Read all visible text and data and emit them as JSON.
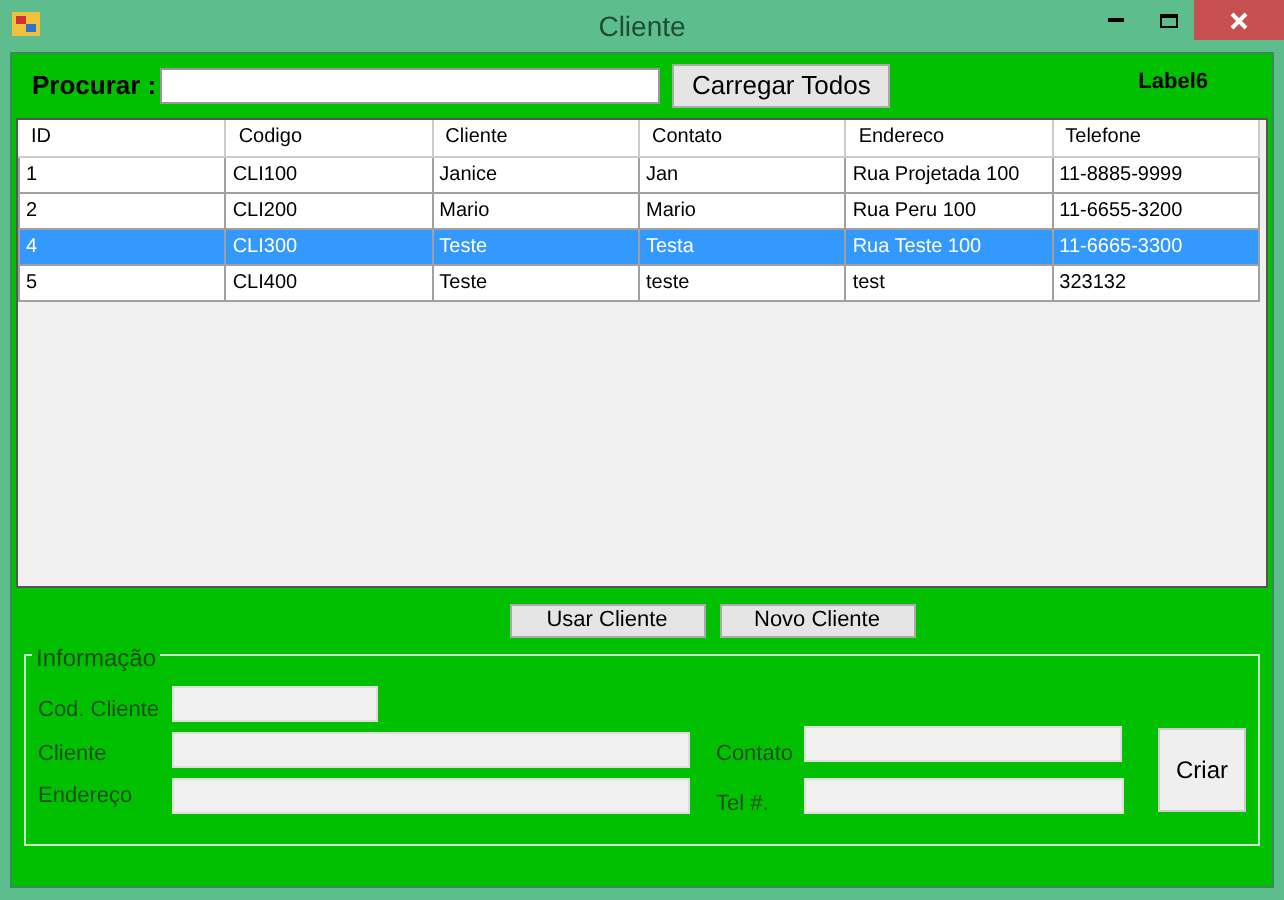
{
  "window": {
    "title": "Cliente"
  },
  "search": {
    "label": "Procurar :"
  },
  "load_all_button": "Carregar Todos",
  "status_label": "Label6",
  "table": {
    "columns": [
      "ID",
      "Codigo",
      "Cliente",
      "Contato",
      "Endereco",
      "Telefone"
    ],
    "rows": [
      {
        "cells": [
          "1",
          "CLI100",
          "Janice",
          "Jan",
          "Rua Projetada 100",
          "11-8885-9999"
        ],
        "selected": false
      },
      {
        "cells": [
          "2",
          "CLI200",
          "Mario",
          "Mario",
          "Rua Peru 100",
          "11-6655-3200"
        ],
        "selected": false
      },
      {
        "cells": [
          "4",
          "CLI300",
          "Teste",
          "Testa",
          "Rua Teste 100",
          "11-6665-3300"
        ],
        "selected": true
      },
      {
        "cells": [
          "5",
          "CLI400",
          "Teste",
          "teste",
          "test",
          "323132"
        ],
        "selected": false
      }
    ]
  },
  "action_buttons": [
    "Usar Cliente",
    "Novo Cliente"
  ],
  "info_group": {
    "title": "Informação",
    "fields": {
      "code": "Cod. Cliente",
      "client": "Cliente",
      "address": "Endereço",
      "contact": "Contato",
      "phone": "Tel #."
    },
    "create_button": "Criar"
  }
}
